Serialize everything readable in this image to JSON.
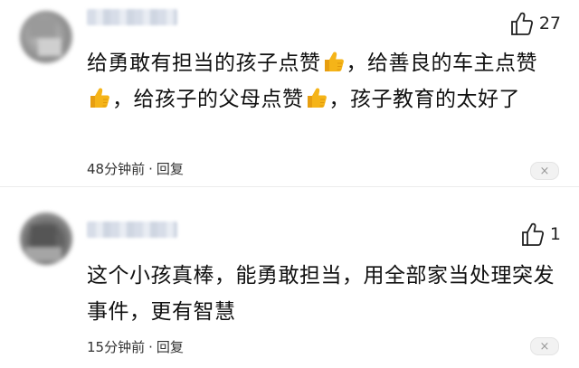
{
  "comments": [
    {
      "likes": "27",
      "text_parts": [
        "给勇敢有担当的孩子点赞",
        "，给善良的车主点赞",
        "，给孩子的父母点赞",
        "，孩子教育的太好了"
      ],
      "time": "48分钟前",
      "separator": "·",
      "reply_label": "回复",
      "close_glyph": "×"
    },
    {
      "likes": "1",
      "text": "这个小孩真棒，能勇敢担当，用全部家当处理突发事件，更有智慧",
      "time": "15分钟前",
      "separator": "·",
      "reply_label": "回复",
      "close_glyph": "×"
    }
  ],
  "icons": {
    "like": "thumbs-up-outline-icon",
    "emoji": "thumbs-up-emoji-icon",
    "close": "close-icon"
  },
  "colors": {
    "emoji_yellow": "#f5b418",
    "text": "#111111",
    "meta": "#333333"
  }
}
